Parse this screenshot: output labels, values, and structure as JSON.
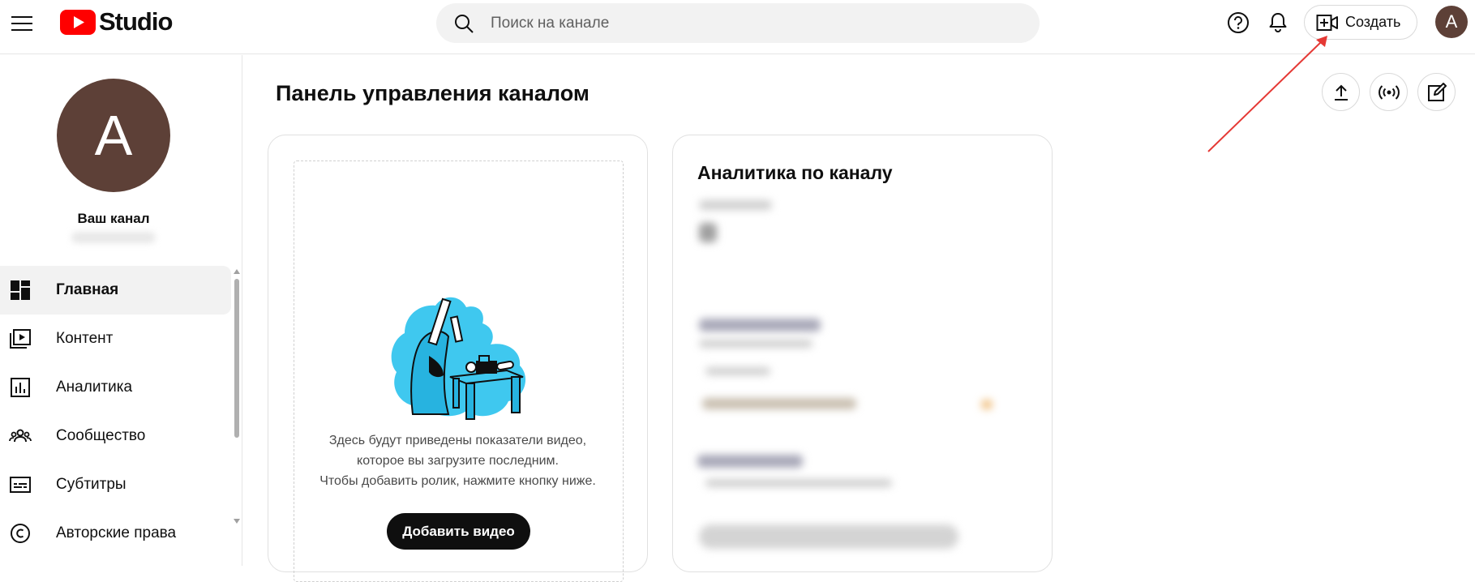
{
  "header": {
    "logo_text": "Studio",
    "search_placeholder": "Поиск на канале",
    "create_label": "Создать",
    "avatar_letter": "A"
  },
  "sidebar": {
    "avatar_letter": "A",
    "channel_label": "Ваш канал",
    "items": [
      {
        "label": "Главная",
        "icon": "dashboard-icon",
        "active": true
      },
      {
        "label": "Контент",
        "icon": "content-icon",
        "active": false
      },
      {
        "label": "Аналитика",
        "icon": "analytics-icon",
        "active": false
      },
      {
        "label": "Сообщество",
        "icon": "community-icon",
        "active": false
      },
      {
        "label": "Субтитры",
        "icon": "subtitles-icon",
        "active": false
      },
      {
        "label": "Авторские права",
        "icon": "copyright-icon",
        "active": false
      }
    ]
  },
  "main": {
    "title": "Панель управления каналом",
    "upload_card": {
      "line1": "Здесь будут приведены показатели видео,",
      "line2": "которое вы загрузите последним.",
      "line3": "Чтобы добавить ролик, нажмите кнопку ниже.",
      "button_label": "Добавить видео"
    },
    "analytics_card": {
      "title": "Аналитика по каналу"
    }
  },
  "colors": {
    "brand_red": "#ff0000",
    "avatar_brown": "#5d4037",
    "illustration_cyan": "#3fc8ef",
    "annotation_arrow": "#e53935"
  }
}
